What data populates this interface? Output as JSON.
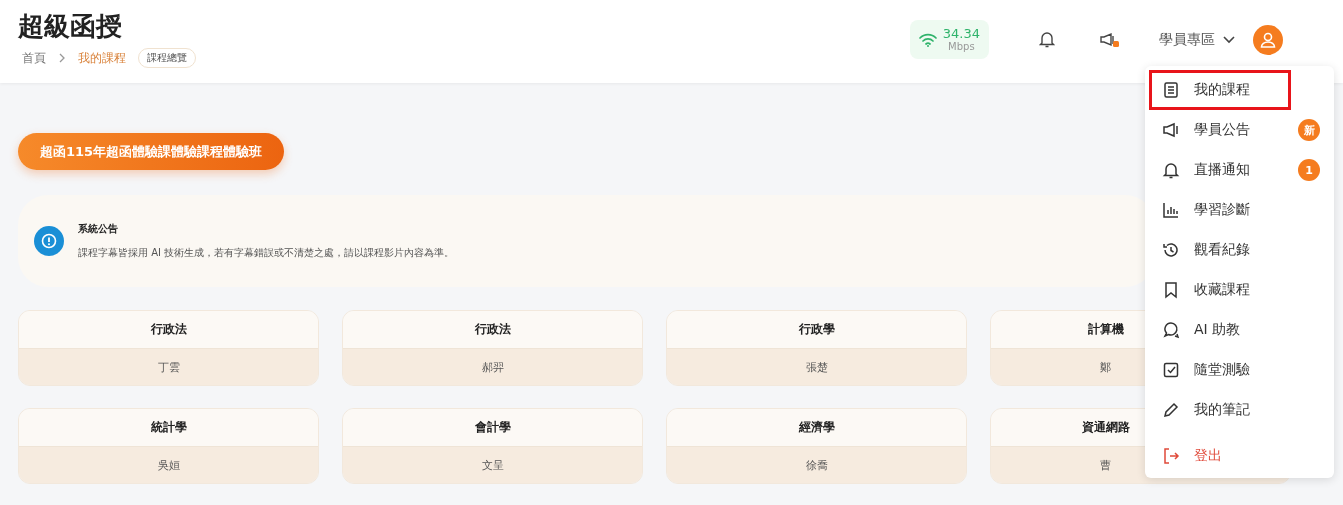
{
  "header": {
    "title": "超級函授",
    "breadcrumb": [
      {
        "label": "首頁",
        "selected": false
      },
      {
        "label": "我的課程",
        "selected": true
      }
    ],
    "badge": "課程總覽"
  },
  "speed": {
    "value": "34.34",
    "unit": "Mbps"
  },
  "user_menu": {
    "label": "學員專區",
    "expanded": true
  },
  "announce_dot": true,
  "course_button": "超函115年超函體驗課體驗課程體驗班",
  "notice": {
    "title": "系統公告",
    "text": "課程字幕皆採用 AI 技術生成，若有字幕錯誤或不清楚之處，請以課程影片內容為準。"
  },
  "courses": [
    {
      "subject": "行政法",
      "teacher": "丁雲"
    },
    {
      "subject": "行政法",
      "teacher": "郝羿"
    },
    {
      "subject": "行政學",
      "teacher": "張楚"
    },
    {
      "subject": "計算機",
      "teacher": "鄭"
    },
    {
      "subject": "統計學",
      "teacher": "吳姮"
    },
    {
      "subject": "會計學",
      "teacher": "文呈"
    },
    {
      "subject": "經濟學",
      "teacher": "徐喬"
    },
    {
      "subject": "資通網路",
      "teacher": "曹"
    }
  ],
  "menu": [
    {
      "kind": "book",
      "label": "我的課程",
      "selected": true
    },
    {
      "kind": "megaphone",
      "label": "學員公告",
      "selected": false,
      "badge": "新"
    },
    {
      "kind": "bell",
      "label": "直播通知",
      "selected": false,
      "badge": "1"
    },
    {
      "kind": "chart",
      "label": "學習診斷",
      "selected": false
    },
    {
      "kind": "history",
      "label": "觀看紀錄",
      "selected": false
    },
    {
      "kind": "bookmark",
      "label": "收藏課程",
      "selected": false
    },
    {
      "kind": "chat",
      "label": "AI 助教",
      "selected": false
    },
    {
      "kind": "check",
      "label": "隨堂測驗",
      "selected": false
    },
    {
      "kind": "pen",
      "label": "我的筆記",
      "selected": false
    },
    {
      "kind": "logout",
      "label": "登出",
      "selected": false
    }
  ]
}
